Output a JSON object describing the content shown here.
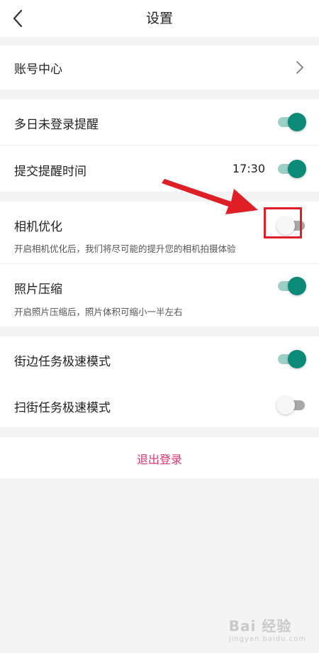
{
  "header": {
    "title": "设置",
    "back_icon": "chevron-left-icon"
  },
  "account": {
    "label": "账号中心"
  },
  "reminders": {
    "multi_day_label": "多日未登录提醒",
    "multi_day_on": true,
    "submit_time_label": "提交提醒时间",
    "submit_time_value": "17:30",
    "submit_time_on": true
  },
  "camera": {
    "label": "相机优化",
    "desc": "开启相机优化后，我们将尽可能的提升您的相机拍摄体验",
    "on": false
  },
  "photo": {
    "label": "照片压缩",
    "desc": "开启照片压缩后，照片体积可缩小一半左右",
    "on": true
  },
  "tasks": {
    "street_label": "街边任务极速模式",
    "street_on": true,
    "sweep_label": "扫街任务极速模式",
    "sweep_on": false
  },
  "logout": {
    "label": "退出登录"
  },
  "colors": {
    "accent": "#0b8a78",
    "logout": "#e0346e",
    "annotation": "#e01e26"
  },
  "watermark": {
    "brand": "Bai 经验",
    "sub": "jingyan.baidu.com"
  }
}
